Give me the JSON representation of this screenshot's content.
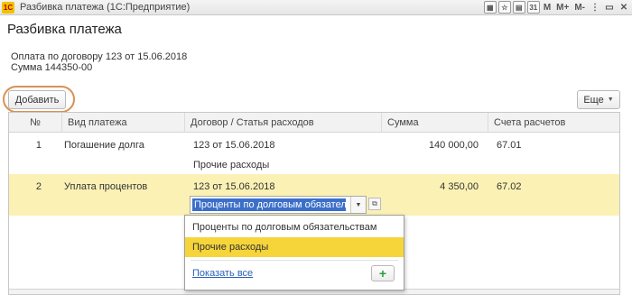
{
  "window": {
    "app_icon": "1C",
    "title": "Разбивка платежа  (1С:Предприятие)",
    "buttons": [
      "M",
      "M+",
      "M-"
    ]
  },
  "page_title": "Разбивка платежа",
  "info": {
    "line1": "Оплата по договору 123 от 15.06.2018",
    "line2": "Сумма 144350-00"
  },
  "toolbar": {
    "add_label": "Добавить",
    "more_label": "Еще"
  },
  "table": {
    "columns": [
      "№",
      "Вид платежа",
      "Договор / Статья расходов",
      "Сумма",
      "Счета расчетов"
    ],
    "rows": [
      {
        "num": "1",
        "type": "Погашение долга",
        "contract": "123 от 15.06.2018",
        "article": "Прочие расходы",
        "sum": "140 000,00",
        "account": "67.01"
      },
      {
        "num": "2",
        "type": "Уплата процентов",
        "contract": "123 от 15.06.2018",
        "article": "Проценты по долговым обязательст",
        "sum": "4 350,00",
        "account": "67.02"
      }
    ]
  },
  "dropdown": {
    "options": [
      "Проценты по долговым обязательствам",
      "Прочие расходы"
    ],
    "highlighted": "Прочие расходы",
    "show_all": "Показать все"
  },
  "colors": {
    "selected_row": "#fbf1b4",
    "highlight": "#f6d53b",
    "ring": "#d99150",
    "link": "#2a61b8"
  }
}
